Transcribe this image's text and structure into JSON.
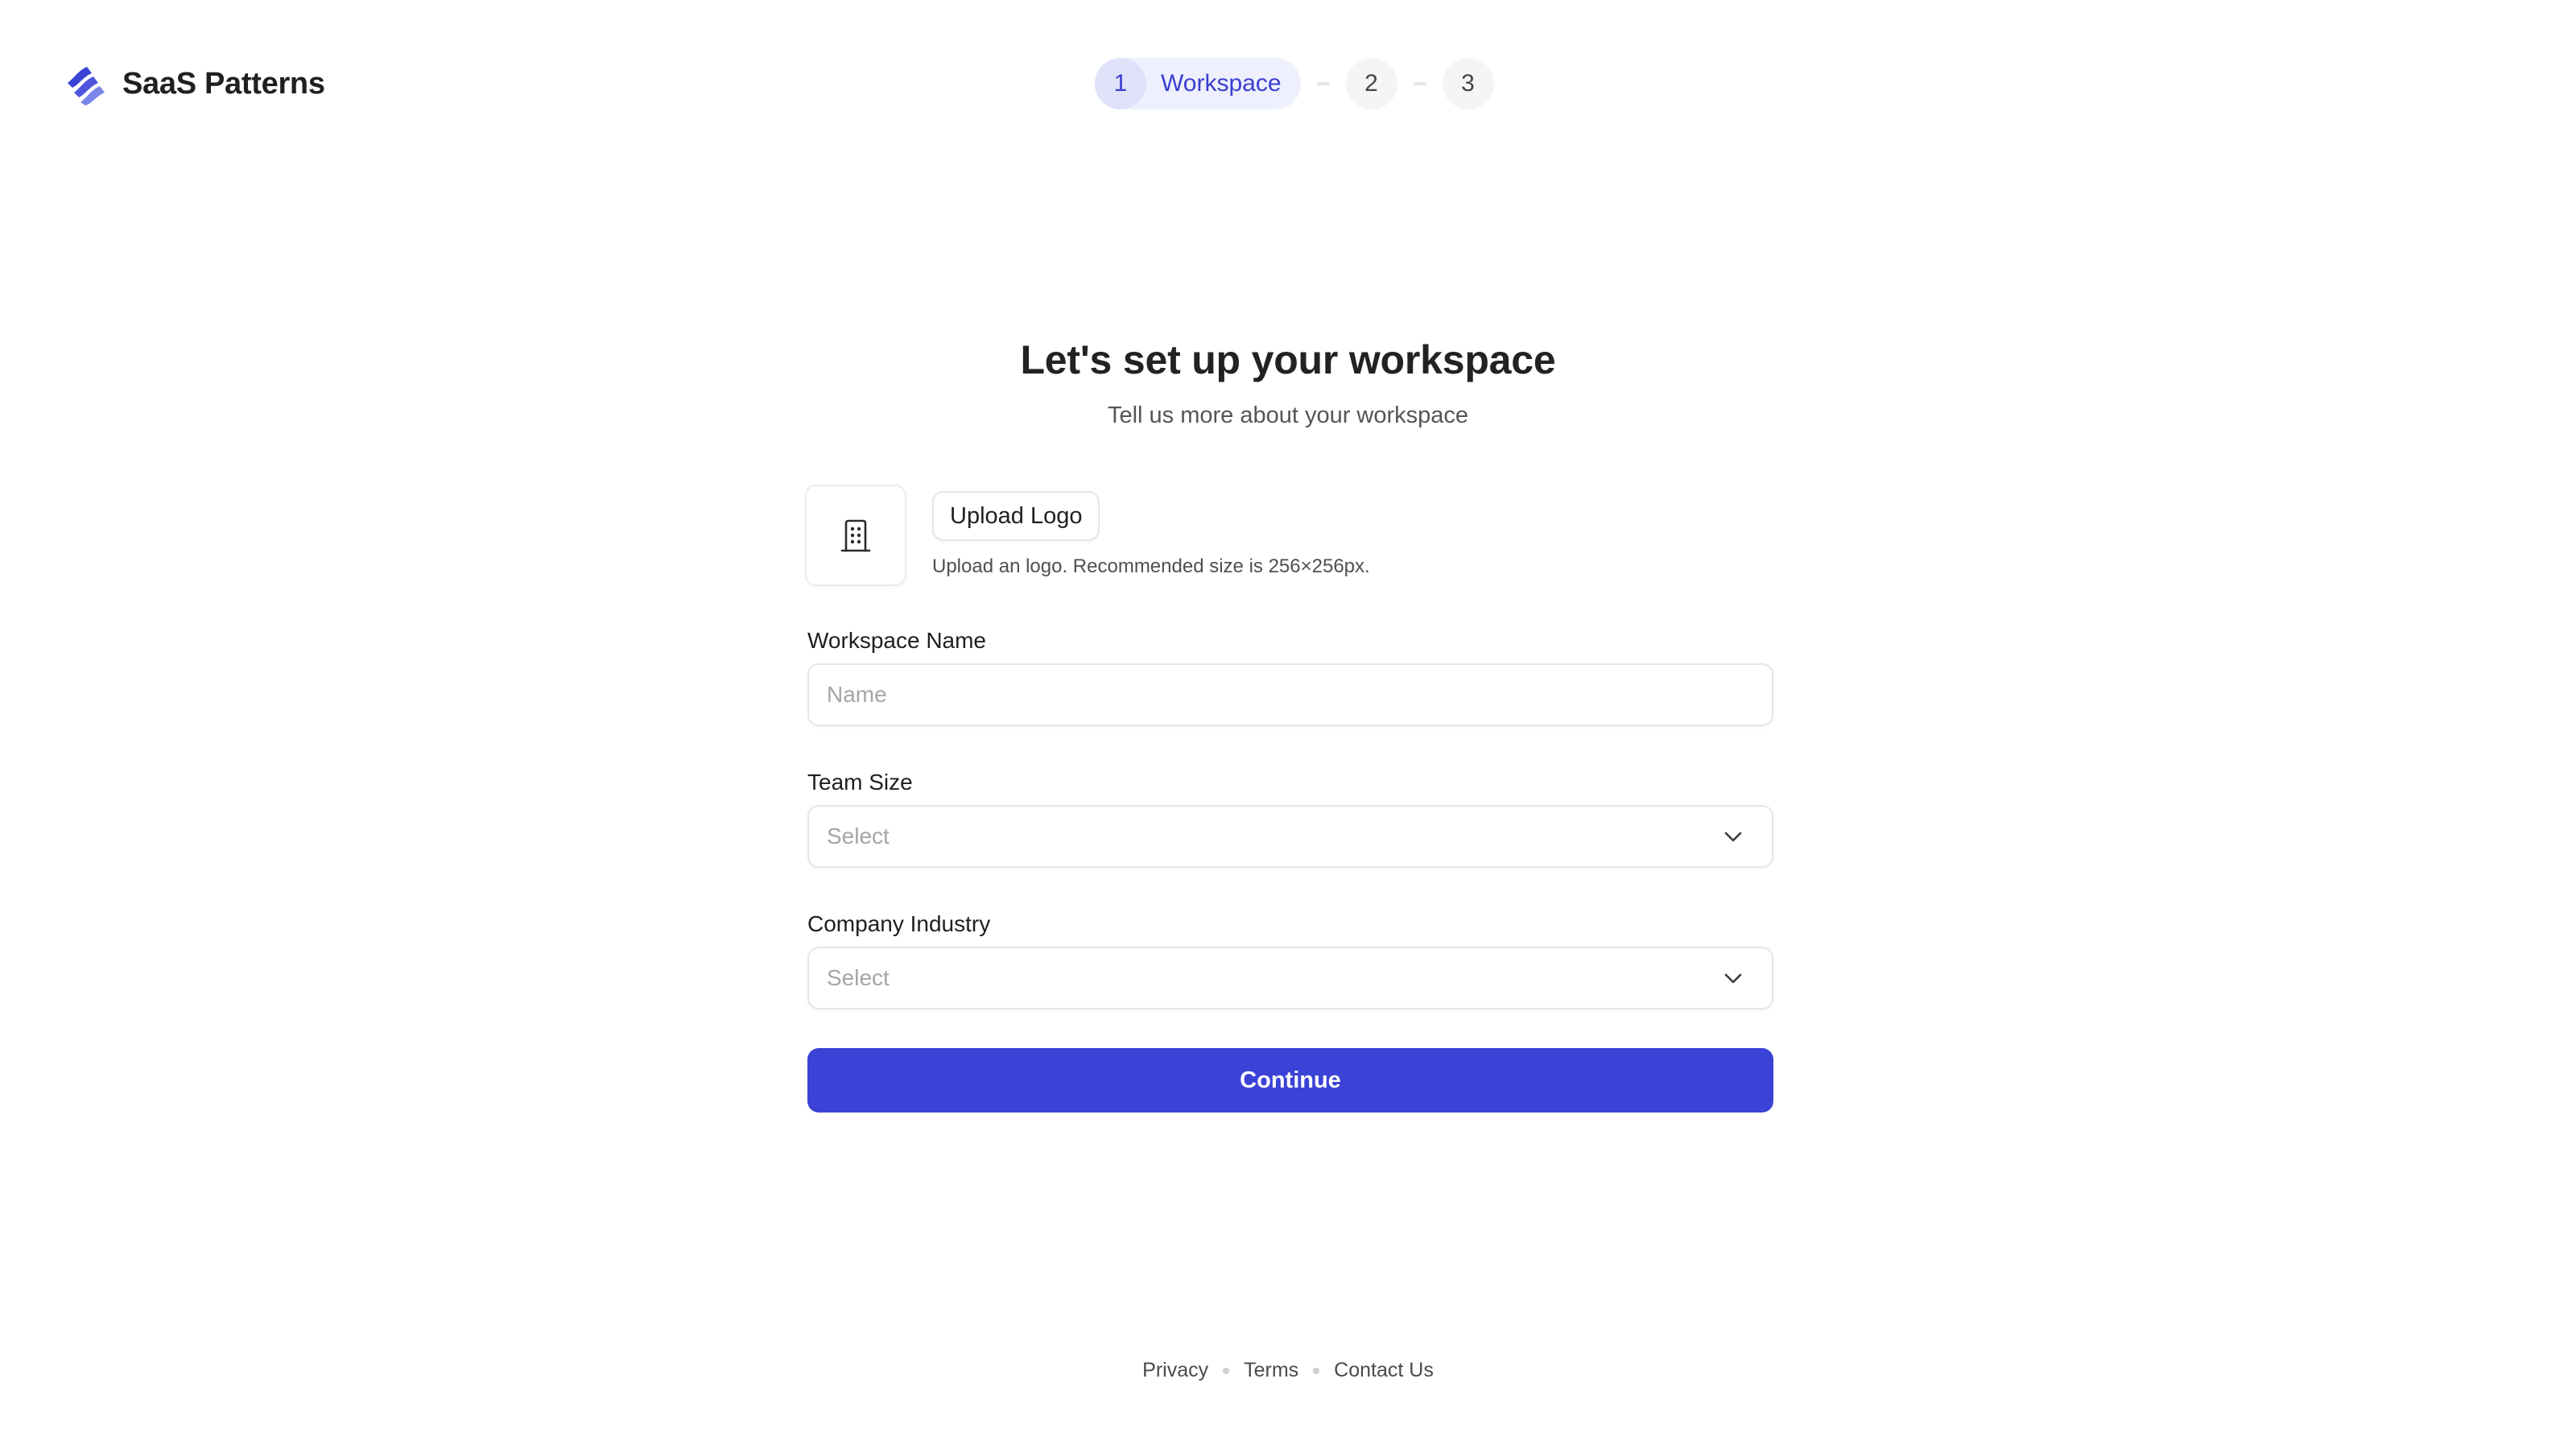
{
  "brand": {
    "name": "SaaS Patterns",
    "icon": "stacked-waves-logo",
    "colors": [
      "#3b42d6",
      "#5a60e0",
      "#7a86ea"
    ]
  },
  "stepper": {
    "steps": [
      {
        "number": "1",
        "label": "Workspace",
        "state": "active"
      },
      {
        "number": "2",
        "label": "",
        "state": "upcoming"
      },
      {
        "number": "3",
        "label": "",
        "state": "upcoming"
      }
    ]
  },
  "page": {
    "title": "Let's set up your workspace",
    "subtitle": "Tell us more about your workspace"
  },
  "logo_upload": {
    "placeholder_icon": "building-icon",
    "button_label": "Upload Logo",
    "helper_text": "Upload an logo. Recommended size is 256×256px."
  },
  "form": {
    "workspace_name": {
      "label": "Workspace Name",
      "value": "",
      "placeholder": "Name"
    },
    "team_size": {
      "label": "Team Size",
      "value": "",
      "placeholder": "Select"
    },
    "company_industry": {
      "label": "Company Industry",
      "value": "",
      "placeholder": "Select"
    },
    "submit_label": "Continue"
  },
  "colors": {
    "accent": "#3b42d6",
    "accent_soft": "#eef0fd",
    "border": "#e6e6e6"
  },
  "footer": {
    "links": [
      "Privacy",
      "Terms",
      "Contact Us"
    ]
  }
}
